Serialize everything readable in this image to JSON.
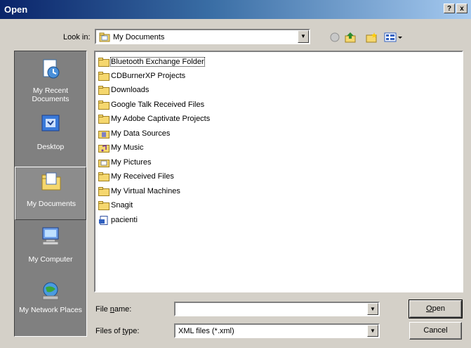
{
  "window": {
    "title": "Open",
    "help_glyph": "?",
    "close_glyph": "x"
  },
  "lookin": {
    "label": "Look in:",
    "value": "My Documents",
    "toolbar": [
      "back-icon",
      "up-folder-icon",
      "new-folder-icon",
      "view-menu-icon"
    ]
  },
  "places": [
    {
      "label": "My Recent Documents",
      "icon": "recent-documents-icon"
    },
    {
      "label": "Desktop",
      "icon": "desktop-icon"
    },
    {
      "label": "My Documents",
      "icon": "my-documents-icon",
      "selected": true
    },
    {
      "label": "My Computer",
      "icon": "my-computer-icon"
    },
    {
      "label": "My Network Places",
      "icon": "network-places-icon"
    }
  ],
  "files": [
    {
      "name": "Bluetooth Exchange Folder",
      "type": "folder"
    },
    {
      "name": "CDBurnerXP Projects",
      "type": "folder"
    },
    {
      "name": "Downloads",
      "type": "folder"
    },
    {
      "name": "Google Talk Received Files",
      "type": "folder"
    },
    {
      "name": "My Adobe Captivate Projects",
      "type": "folder"
    },
    {
      "name": "My Data Sources",
      "type": "special-folder"
    },
    {
      "name": "My Music",
      "type": "special-folder"
    },
    {
      "name": "My Pictures",
      "type": "special-folder"
    },
    {
      "name": "My Received Files",
      "type": "folder"
    },
    {
      "name": "My Virtual Machines",
      "type": "folder"
    },
    {
      "name": "Snagit",
      "type": "folder"
    },
    {
      "name": "pacienti",
      "type": "file"
    }
  ],
  "filename": {
    "label_pre": "File ",
    "label_ul": "n",
    "label_post": "ame:",
    "value": ""
  },
  "filetype": {
    "label_pre": "Files of ",
    "label_ul": "t",
    "label_post": "ype:",
    "value": "XML files (*.xml)"
  },
  "buttons": {
    "open_ul": "O",
    "open_rest": "pen",
    "cancel": "Cancel"
  },
  "colors": {
    "titlebar_start": "#0a246a",
    "titlebar_end": "#a6caf0",
    "folder_yellow": "#f5d76e",
    "places_bg": "#808080"
  }
}
